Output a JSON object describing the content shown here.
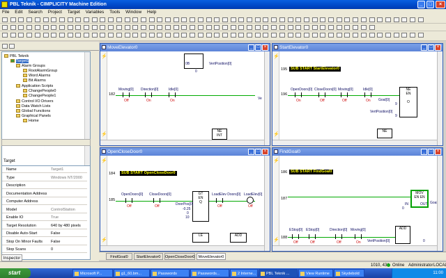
{
  "title": "PBL Teknik - CIMPLICITY Machine Edition",
  "menu": [
    "File",
    "Edit",
    "Search",
    "Project",
    "Target",
    "Variables",
    "Tools",
    "Window",
    "Help"
  ],
  "tree": {
    "root": "PBL Teknik",
    "items": [
      {
        "label": "Target1",
        "level": 1,
        "selected": true
      },
      {
        "label": "Alarm Groups",
        "level": 2
      },
      {
        "label": "RootAlarmGroup",
        "level": 3
      },
      {
        "label": "Word Alarms",
        "level": 3
      },
      {
        "label": "Bit Alarms",
        "level": 3
      },
      {
        "label": "Application Scripts",
        "level": 2
      },
      {
        "label": "ChangePeople0",
        "level": 3
      },
      {
        "label": "ChangePeople1",
        "level": 3
      },
      {
        "label": "Control I/O Drivers",
        "level": 2
      },
      {
        "label": "Data Watch Lists",
        "level": 2
      },
      {
        "label": "Global Functions",
        "level": 2
      },
      {
        "label": "Graphical Panels",
        "level": 2
      },
      {
        "label": "Home",
        "level": 3
      }
    ]
  },
  "inspector": {
    "header": "Target",
    "tab": "Inspector",
    "rows": [
      {
        "k": "Name",
        "v": "Target1",
        "dark": false
      },
      {
        "k": "Type",
        "v": "Windows NT/2000",
        "dark": false
      },
      {
        "k": "Description",
        "v": "",
        "dark": false
      },
      {
        "k": "Documentation Address",
        "v": "",
        "dark": false
      },
      {
        "k": "Computer Address",
        "v": "",
        "dark": false
      },
      {
        "k": "Model",
        "v": "ControlStation",
        "dark": false
      },
      {
        "k": "Enable IO",
        "v": "True",
        "dark": false
      },
      {
        "k": "Target Resolution",
        "v": "640 by 480 pixels",
        "dark": true
      },
      {
        "k": "Disable Auto-Start",
        "v": "False",
        "dark": true
      },
      {
        "k": "Stop On Minor Faults",
        "v": "False",
        "dark": true
      },
      {
        "k": "Stop Scans",
        "v": "0",
        "dark": true
      }
    ]
  },
  "windows": {
    "move": {
      "title": "MoveElevator0",
      "rung": "182",
      "labels": [
        "Moving[0]",
        "Direction[0]",
        "Idle[0]"
      ],
      "states": [
        "Off",
        "On",
        "On"
      ],
      "top_tag": "VertPosition[0]",
      "top_val": "0B",
      "top_val2": "0",
      "blk": "NE",
      "blkrow": "INT",
      "tail": "Ve"
    },
    "start": {
      "title": "StartElevator0",
      "rung1": "195",
      "banner": "SUB START StartElevator0",
      "rung2": "196",
      "labels": [
        "OpenDoors[0]",
        "CloseDoors[0]",
        "Moving[0]",
        "Idle[0]"
      ],
      "states": [
        "On",
        "Off",
        "Off",
        "On"
      ],
      "blk": "NE",
      "blk_en": "EN",
      "blk_o": "O",
      "goal": "Goal[0]",
      "goalv": "9",
      "vert": "VertPosition[0]",
      "vertv": "9",
      "blk2": "NE"
    },
    "open": {
      "title": "OpenCloseDoor0",
      "rung1": "184",
      "banner": "SUB START OpenCloseDoor0",
      "rung2": "185",
      "labels": [
        "OpenDoors[0]",
        "CloseDoors[0]",
        "LoadElev Doors[0]",
        "LoadElev[0]"
      ],
      "states": [
        "Off",
        "Off",
        "Off",
        "Off"
      ],
      "blk": "GT",
      "blk_en": "EN",
      "blk_q": "Q",
      "door": "DoorPos[0]",
      "doorv": "-0.25",
      "doorv2": "0",
      "doorv3": "10",
      "blk2": "LE",
      "blk3": "ADD"
    },
    "find": {
      "title": "FindGoal0",
      "rung1": "186",
      "banner": "SUB START FindGoal0",
      "rung2": "187",
      "rung3": "188",
      "blk": "MOV",
      "blk_en": "EN",
      "blk_en2": "EN",
      "blk_in": "IN",
      "blk_out": "OUT",
      "goal": "Goal[0]",
      "goalv": "0",
      "labels": [
        "EStop[0]",
        "EStop[0]",
        "Direction[0]",
        "Moving[0]"
      ],
      "states": [
        "Off",
        "Off",
        "Off",
        "On"
      ],
      "blk2": "ADD",
      "vert": "VertPosition[0]",
      "vertv": "0"
    }
  },
  "doctabs": [
    "FindGoal0",
    "StartElevator0",
    "OpenCloseDoor0",
    "MoveElevator0"
  ],
  "status": {
    "coords": "1010, 431",
    "online": "Online",
    "user": "Administrator",
    "loc": "LOCAL"
  },
  "taskbar": {
    "start": "start",
    "tasks": [
      "Microsoft P...",
      "g1_60.bm...",
      "Passwords",
      "Passwords...",
      "2 Interne...",
      "PBL Teknik ...",
      "View Runtime",
      "Skydebold"
    ],
    "tray": "11:00"
  }
}
